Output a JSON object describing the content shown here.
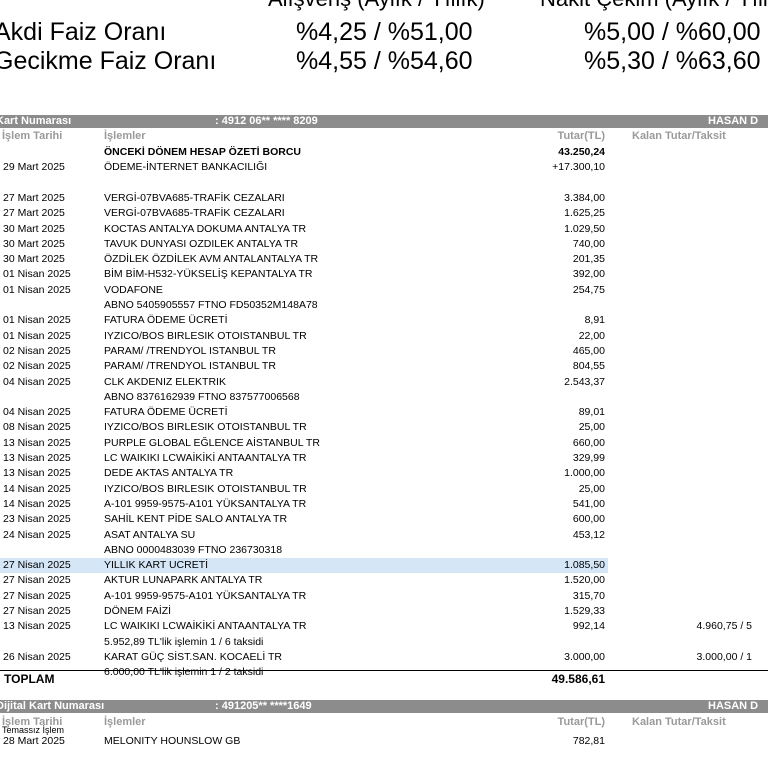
{
  "rates": {
    "header_left": "Alışveriş (Aylık / Yıllık)",
    "header_right": "Nakit Çekim (Aylık / Yıllık)",
    "rows": [
      {
        "label": "Akdi Faiz Oranı",
        "shopping": "%4,25 / %51,00",
        "cash": "%5,00 / %60,00"
      },
      {
        "label": "Gecikme Faiz Oranı",
        "shopping": "%4,55 / %54,60",
        "cash": "%5,30 / %63,60"
      }
    ]
  },
  "card1": {
    "title": "Kart Numarası",
    "number": ": 4912 06** **** 8209",
    "holder": "HASAN D",
    "headers": {
      "date": "İşlem Tarihi",
      "desc": "İşlemler",
      "amount": "Tutar(TL)",
      "remaining": "Kalan Tutar/Taksit"
    },
    "rows": [
      {
        "date": "",
        "desc": "ÖNCEKİ DÖNEM HESAP ÖZETİ BORCU",
        "amount": "43.250,24",
        "remaining": "",
        "bold": true
      },
      {
        "date": "29 Mart 2025",
        "desc": "ÖDEME-İNTERNET BANKACILIĞI",
        "amount": "+17.300,10",
        "remaining": ""
      },
      {
        "date": "",
        "desc": "",
        "amount": "",
        "remaining": ""
      },
      {
        "date": "27 Mart 2025",
        "desc": "VERGİ-07BVA685-TRAFİK CEZALARI",
        "amount": "3.384,00",
        "remaining": ""
      },
      {
        "date": "27 Mart 2025",
        "desc": "VERGİ-07BVA685-TRAFİK CEZALARI",
        "amount": "1.625,25",
        "remaining": ""
      },
      {
        "date": "30 Mart 2025",
        "desc": "KOCTAS ANTALYA DOKUMA    ANTALYA      TR",
        "amount": "1.029,50",
        "remaining": ""
      },
      {
        "date": "30 Mart 2025",
        "desc": "TAVUK DUNYASI OZDILEK     ANTALYA      TR",
        "amount": "740,00",
        "remaining": ""
      },
      {
        "date": "30 Mart 2025",
        "desc": "ÖZDİLEK ÖZDİLEK AVM ANTALANTALYA      TR",
        "amount": "201,35",
        "remaining": ""
      },
      {
        "date": "01 Nisan 2025",
        "desc": "BİM BİM-H532-YÜKSELİŞ KEPANTALYA      TR",
        "amount": "392,00",
        "remaining": ""
      },
      {
        "date": "01 Nisan 2025",
        "desc": "VODAFONE",
        "amount": "254,75",
        "remaining": ""
      },
      {
        "date": "",
        "desc": "ABNO 5405905557 FTNO FD50352M148A78",
        "amount": "",
        "remaining": ""
      },
      {
        "date": "01 Nisan 2025",
        "desc": "FATURA ÖDEME ÜCRETİ",
        "amount": "8,91",
        "remaining": ""
      },
      {
        "date": "01 Nisan 2025",
        "desc": "IYZICO/BOS BIRLESIK OTOISTANBUL      TR",
        "amount": "22,00",
        "remaining": ""
      },
      {
        "date": "02 Nisan 2025",
        "desc": "PARAM/ /TRENDYOL          ISTANBUL      TR",
        "amount": "465,00",
        "remaining": ""
      },
      {
        "date": "02 Nisan 2025",
        "desc": "PARAM/ /TRENDYOL          ISTANBUL      TR",
        "amount": "804,55",
        "remaining": ""
      },
      {
        "date": "04 Nisan 2025",
        "desc": "CLK AKDENIZ ELEKTRIK",
        "amount": "2.543,37",
        "remaining": ""
      },
      {
        "date": "",
        "desc": "ABNO 8376162939 FTNO 837577006568",
        "amount": "",
        "remaining": ""
      },
      {
        "date": "04 Nisan 2025",
        "desc": "FATURA ÖDEME ÜCRETİ",
        "amount": "89,01",
        "remaining": ""
      },
      {
        "date": "08 Nisan 2025",
        "desc": "IYZICO/BOS BIRLESIK OTOISTANBUL      TR",
        "amount": "25,00",
        "remaining": ""
      },
      {
        "date": "13 Nisan 2025",
        "desc": "PURPLE GLOBAL EĞLENCE AİSTANBUL      TR",
        "amount": "660,00",
        "remaining": ""
      },
      {
        "date": "13 Nisan 2025",
        "desc": "LC WAIKIKI LCWAİKİKİ ANTAANTALYA      TR",
        "amount": "329,99",
        "remaining": ""
      },
      {
        "date": "13 Nisan 2025",
        "desc": "DEDE AKTAS               ANTALYA      TR",
        "amount": "1.000,00",
        "remaining": ""
      },
      {
        "date": "14 Nisan 2025",
        "desc": "IYZICO/BOS BIRLESIK OTOISTANBUL      TR",
        "amount": "25,00",
        "remaining": ""
      },
      {
        "date": "14 Nisan 2025",
        "desc": "A-101 9959-9575-A101 YÜKSANTALYA      TR",
        "amount": "541,00",
        "remaining": ""
      },
      {
        "date": "23 Nisan 2025",
        "desc": "SAHİL KENT PİDE SALO    ANTALYA      TR",
        "amount": "600,00",
        "remaining": ""
      },
      {
        "date": "24 Nisan 2025",
        "desc": "ASAT ANTALYA SU",
        "amount": "453,12",
        "remaining": ""
      },
      {
        "date": "",
        "desc": "ABNO 0000483039               FTNO 236730318",
        "amount": "",
        "remaining": ""
      },
      {
        "date": "27 Nisan 2025",
        "desc": "YILLIK KART UCRETİ",
        "amount": "1.085,50",
        "remaining": "",
        "highlight": true
      },
      {
        "date": "27 Nisan 2025",
        "desc": "AKTUR LUNAPARK           ANTALYA      TR",
        "amount": "1.520,00",
        "remaining": ""
      },
      {
        "date": "27 Nisan 2025",
        "desc": "A-101 9959-9575-A101 YÜKSANTALYA      TR",
        "amount": "315,70",
        "remaining": ""
      },
      {
        "date": "27 Nisan 2025",
        "desc": "DÖNEM FAİZİ",
        "amount": "1.529,33",
        "remaining": ""
      },
      {
        "date": "13 Nisan 2025",
        "desc": "LC WAIKIKI LCWAİKİKİ ANTAANTALYA      TR",
        "amount": "992,14",
        "remaining": "4.960,75 / 5"
      },
      {
        "date": "",
        "desc": "5.952,89 TL'lik işlemin 1 / 6 taksidi",
        "amount": "",
        "remaining": ""
      },
      {
        "date": "26 Nisan 2025",
        "desc": "KARAT GÜÇ SİST.SAN.    KOCAELİ      TR",
        "amount": "3.000,00",
        "remaining": "3.000,00 / 1"
      },
      {
        "date": "",
        "desc": "6.000,00 TL'lik işlemin 1 / 2 taksidi",
        "amount": "",
        "remaining": ""
      }
    ],
    "total_label": "TOPLAM",
    "total_value": "49.586,61"
  },
  "card2": {
    "title": "Dijital Kart Numarası",
    "number": ": 491205** ****1649",
    "holder": "HASAN D",
    "headers": {
      "date": "İşlem Tarihi",
      "desc": "İşlemler",
      "amount": "Tutar(TL)",
      "remaining": "Kalan Tutar/Taksit"
    },
    "note": "Temassız İşlem",
    "rows": [
      {
        "date": "28 Mart 2025",
        "desc": "MELONITY              HOUNSLOW       GB",
        "amount": "782,81",
        "remaining": ""
      }
    ]
  }
}
